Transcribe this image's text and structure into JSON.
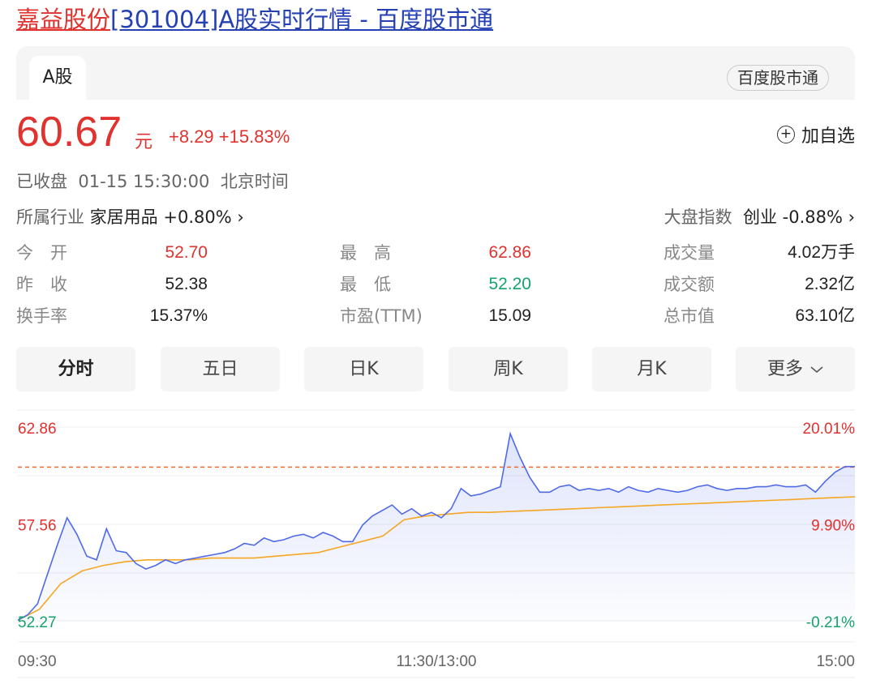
{
  "title": {
    "name": "嘉益股份",
    "rest": "[301004]A股实时行情 - 百度股市通"
  },
  "tabs": {
    "active": "A股"
  },
  "source_badge": "百度股市通",
  "quote": {
    "price": "60.67",
    "unit": "元",
    "change": "+8.29",
    "change_pct": "+15.83%"
  },
  "watch_label": "加自选",
  "status": "已收盘  01-15 15:30:00  北京时间",
  "industry": {
    "label": "所属行业",
    "value": "家居用品 +0.80% ›"
  },
  "market_index": {
    "label": "大盘指数",
    "value": "创业 -0.88% ›"
  },
  "stats": {
    "open": {
      "label": "今　开",
      "value": "52.70"
    },
    "prev_close": {
      "label": "昨　收",
      "value": "52.38"
    },
    "turnover": {
      "label": "换手率",
      "value": "15.37%"
    },
    "high": {
      "label": "最　高",
      "value": "62.86"
    },
    "low": {
      "label": "最　低",
      "value": "52.20"
    },
    "pe": {
      "label": "市盈(TTM)",
      "value": "15.09"
    },
    "volume": {
      "label": "成交量",
      "value": "4.02万手"
    },
    "amount": {
      "label": "成交额",
      "value": "2.32亿"
    },
    "market_cap": {
      "label": "总市值",
      "value": "63.10亿"
    }
  },
  "period_tabs": [
    "分时",
    "五日",
    "日K",
    "周K",
    "月K",
    "更多"
  ],
  "colors": {
    "up": "#e0322e",
    "down": "#15a36c",
    "price_line": "#4f6ae8",
    "avg_line": "#f5a623",
    "link": "#2440b3"
  },
  "chart_data": {
    "type": "line",
    "y_left_labels": [
      "62.86",
      "57.56",
      "52.27"
    ],
    "y_right_labels": [
      "20.01%",
      "9.90%",
      "-0.21%"
    ],
    "x_labels": [
      "09:30",
      "11:30/13:00",
      "15:00"
    ],
    "ylim": [
      52.27,
      62.86
    ],
    "reference_price": 60.67,
    "series": [
      {
        "values": [
          52.3,
          52.6,
          53.2,
          54.8,
          56.4,
          57.9,
          57.0,
          55.8,
          55.6,
          57.3,
          56.1,
          56.0,
          55.4,
          55.1,
          55.3,
          55.6,
          55.4,
          55.6,
          55.7,
          55.8,
          55.9,
          56.0,
          56.2,
          56.5,
          56.4,
          56.8,
          56.6,
          56.7,
          56.9,
          57.0,
          56.8,
          57.1,
          56.9,
          56.6,
          56.6,
          57.5,
          58.0,
          58.3,
          58.6,
          58.1,
          58.4,
          58.0,
          58.2,
          57.9,
          58.4,
          59.5,
          59.1,
          59.2,
          59.4,
          59.6,
          62.5,
          61.2,
          60.1,
          59.3,
          59.3,
          59.6,
          59.7,
          59.4,
          59.5,
          59.4,
          59.5,
          59.3,
          59.6,
          59.4,
          59.3,
          59.5,
          59.4,
          59.3,
          59.4,
          59.6,
          59.7,
          59.5,
          59.4,
          59.5,
          59.5,
          59.6,
          59.6,
          59.7,
          59.6,
          59.6,
          59.7,
          59.3,
          59.9,
          60.4,
          60.7,
          60.7
        ]
      },
      {
        "values": [
          52.3,
          52.9,
          54.3,
          55.0,
          55.3,
          55.5,
          55.6,
          55.6,
          55.6,
          55.7,
          55.7,
          55.7,
          55.8,
          55.9,
          56.0,
          56.3,
          56.6,
          56.9,
          57.8,
          58.0,
          58.1,
          58.2,
          58.2,
          58.25,
          58.3,
          58.35,
          58.4,
          58.45,
          58.5,
          58.55,
          58.6,
          58.65,
          58.7,
          58.75,
          58.8,
          58.85,
          58.9,
          58.95,
          59.0,
          59.05
        ]
      }
    ]
  }
}
